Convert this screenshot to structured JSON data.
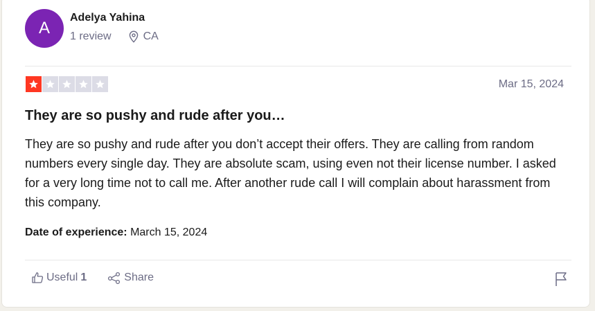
{
  "reviewer": {
    "initial": "A",
    "name": "Adelya Yahina",
    "review_count": "1 review",
    "location": "CA",
    "avatar_color": "#7b24b3"
  },
  "rating": {
    "stars": 1,
    "max": 5,
    "active_color": "#ff3722",
    "inactive_color": "#dcdce6"
  },
  "review": {
    "date": "Mar 15, 2024",
    "title": "They are so pushy and rude after you…",
    "body": "They are so pushy and rude after you don’t accept their offers. They are calling from random numbers every single day. They are absolute scam, using even not their license number. I asked for a very long time not to call me. After another rude call I will complain about harassment from this company.",
    "experience_label": "Date of experience:",
    "experience_date": "March 15, 2024"
  },
  "actions": {
    "useful_label": "Useful",
    "useful_count": "1",
    "share_label": "Share",
    "icons": [
      "thumbs-up-icon",
      "share-icon",
      "flag-icon",
      "location-pin-icon",
      "star-icon"
    ]
  }
}
